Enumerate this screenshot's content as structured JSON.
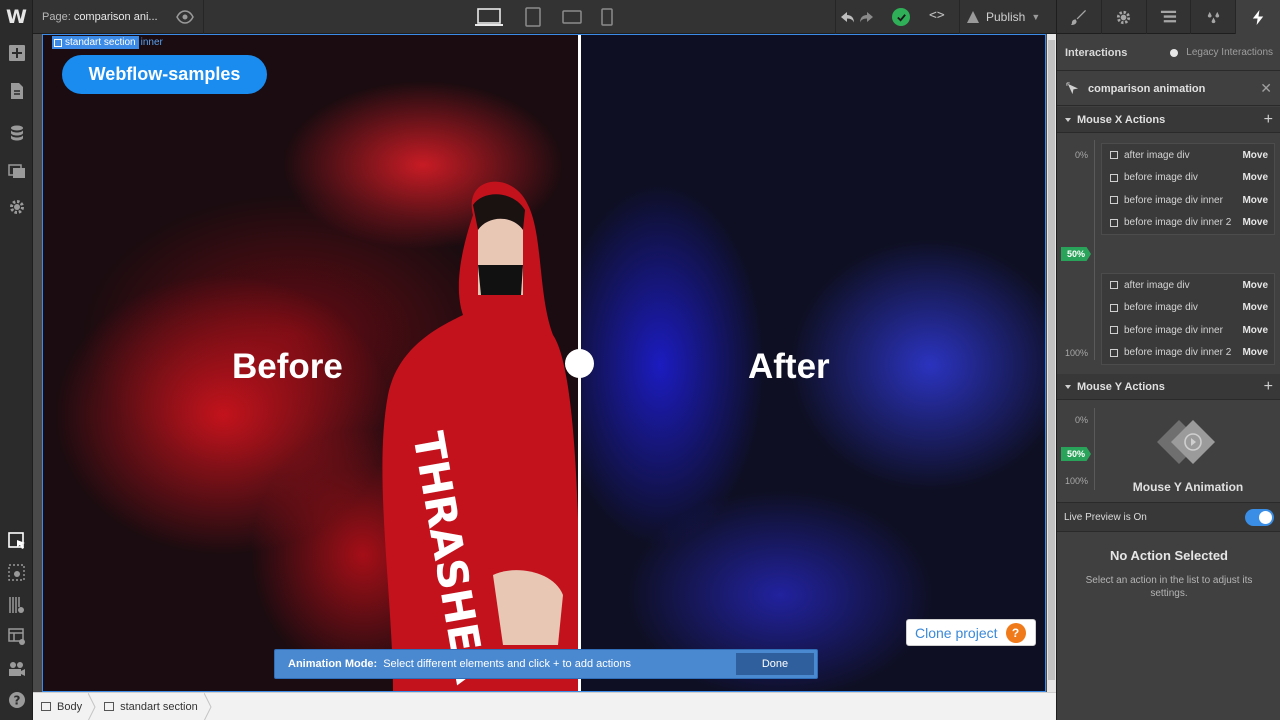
{
  "app": {
    "logo": "W"
  },
  "topbar": {
    "page_prefix": "Page:",
    "page_name": "comparison ani...",
    "publish_label": "Publish",
    "code_label": "<>"
  },
  "canvas": {
    "selected_element": "standart section",
    "selected_child": "inner",
    "brand_label": "Webflow-samples",
    "before_label": "Before",
    "after_label": "After",
    "clone_label": "Clone project",
    "clone_icon": "?",
    "animation_mode_label": "Animation Mode:",
    "animation_mode_msg": "Select different elements and click + to add actions",
    "done_label": "Done"
  },
  "breadcrumbs": [
    {
      "label": "Body"
    },
    {
      "label": "standart section"
    }
  ],
  "panel": {
    "interactions_label": "Interactions",
    "legacy_label": "Legacy Interactions",
    "trigger_name": "comparison animation",
    "mouse_x_title": "Mouse X Actions",
    "mouse_y_title": "Mouse Y Actions",
    "pct_0": "0%",
    "pct_50": "50%",
    "pct_100": "100%",
    "x_actions_start": [
      {
        "name": "after image div",
        "action": "Move"
      },
      {
        "name": "before image div",
        "action": "Move"
      },
      {
        "name": "before image div inner",
        "action": "Move"
      },
      {
        "name": "before image div inner 2",
        "action": "Move"
      }
    ],
    "x_actions_end": [
      {
        "name": "after image div",
        "action": "Move"
      },
      {
        "name": "before image div",
        "action": "Move"
      },
      {
        "name": "before image div inner",
        "action": "Move"
      },
      {
        "name": "before image div inner 2",
        "action": "Move"
      }
    ],
    "mouse_y_animation_label": "Mouse Y Animation",
    "live_preview_label": "Live Preview is On",
    "no_action_title": "No Action Selected",
    "no_action_sub": "Select an action in the list to adjust its settings."
  },
  "colors": {
    "accent": "#3c8ce7",
    "brand_pill": "#1a8cf0",
    "success": "#2aa35a",
    "clone_help": "#f07a1a"
  }
}
